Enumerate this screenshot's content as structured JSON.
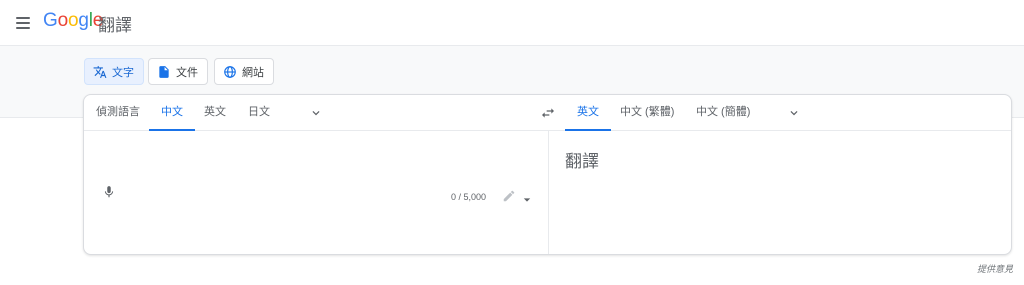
{
  "header": {
    "logo_text": "Google",
    "app_name": "翻譯"
  },
  "modes": [
    {
      "label": "文字",
      "active": true
    },
    {
      "label": "文件",
      "active": false
    },
    {
      "label": "網站",
      "active": false
    }
  ],
  "source_languages": [
    {
      "label": "偵測語言",
      "active": false
    },
    {
      "label": "中文",
      "active": true
    },
    {
      "label": "英文",
      "active": false
    },
    {
      "label": "日文",
      "active": false
    }
  ],
  "target_languages": [
    {
      "label": "英文",
      "active": true
    },
    {
      "label": "中文 (繁體)",
      "active": false
    },
    {
      "label": "中文 (簡體)",
      "active": false
    }
  ],
  "source": {
    "text": "",
    "char_count": "0 / 5,000"
  },
  "target": {
    "placeholder_text": "翻譯"
  },
  "footer": {
    "feedback": "提供意見"
  },
  "colors": {
    "accent": "#1a73e8",
    "text_secondary": "#5f6368"
  }
}
